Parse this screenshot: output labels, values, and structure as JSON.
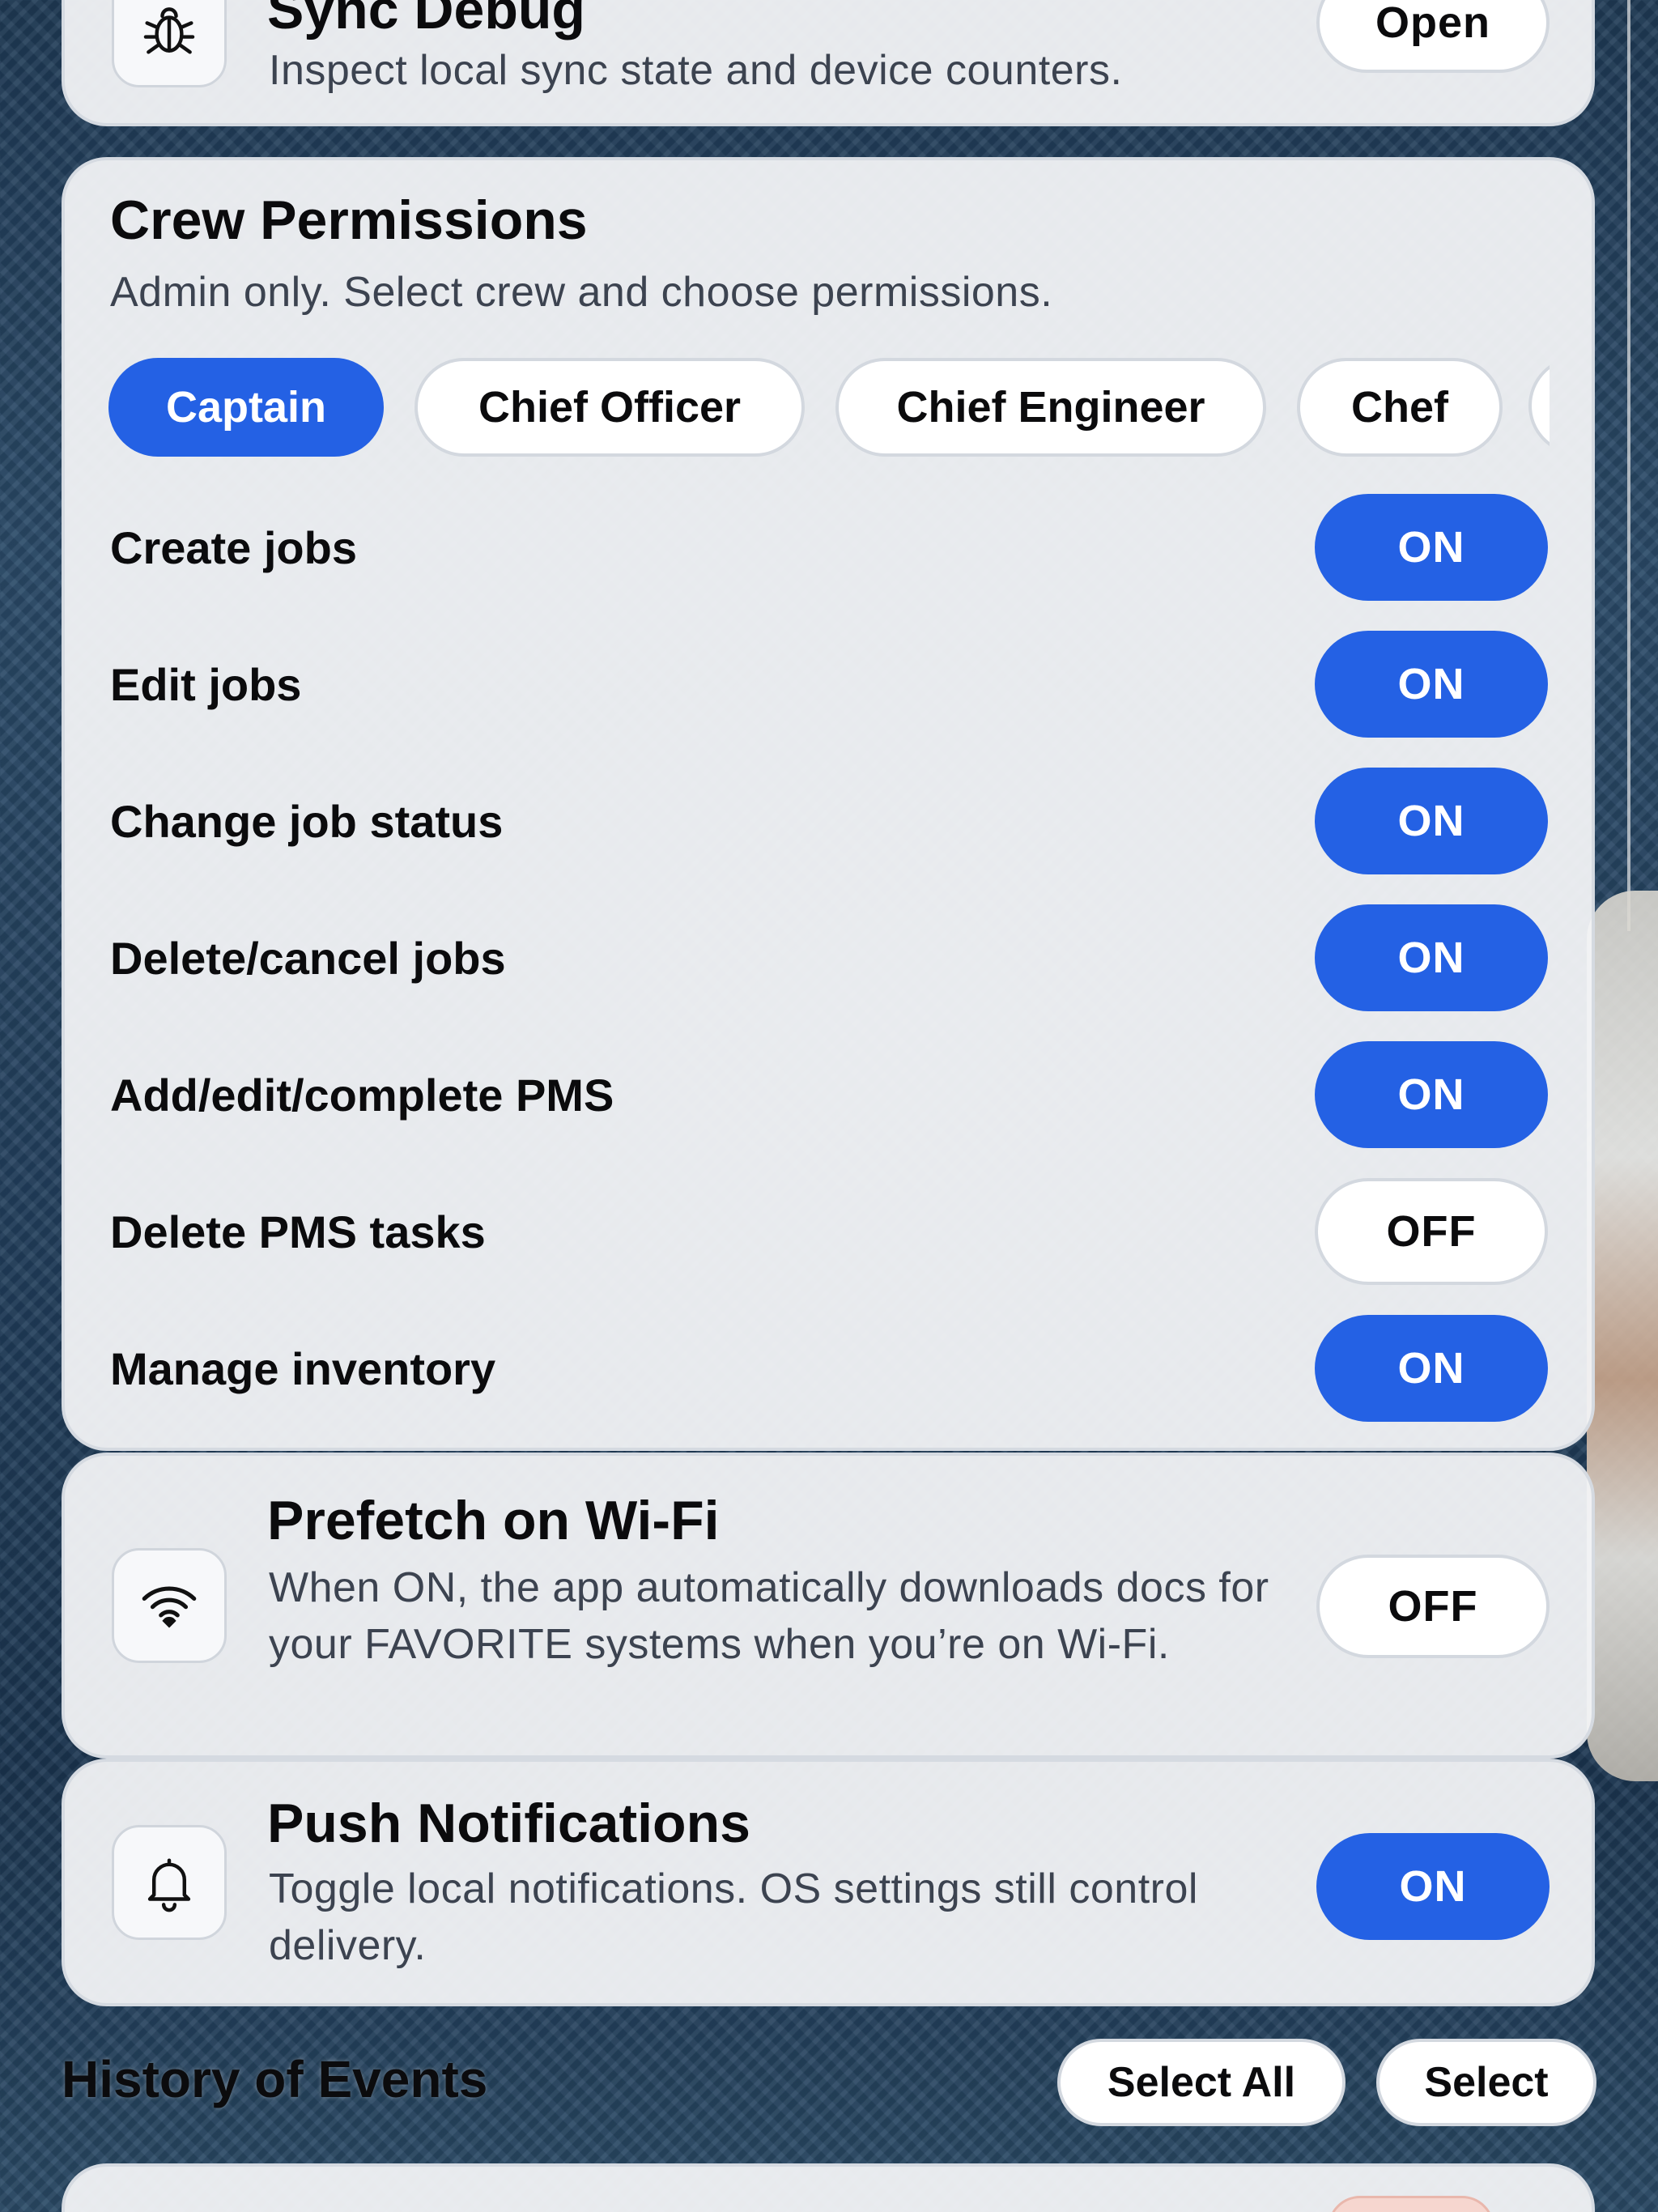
{
  "sync_debug": {
    "title": "Sync Debug",
    "description": "Inspect local sync state and device counters.",
    "button": "Open",
    "icon": "bug-icon"
  },
  "crew_permissions": {
    "title": "Crew Permissions",
    "subtitle": "Admin only. Select crew and choose permissions.",
    "crew": [
      "Captain",
      "Chief Officer",
      "Chief Engineer",
      "Chef"
    ],
    "selected_crew": "Captain",
    "permissions": [
      {
        "label": "Create jobs",
        "state": "ON"
      },
      {
        "label": "Edit jobs",
        "state": "ON"
      },
      {
        "label": "Change job status",
        "state": "ON"
      },
      {
        "label": "Delete/cancel jobs",
        "state": "ON"
      },
      {
        "label": "Add/edit/complete PMS",
        "state": "ON"
      },
      {
        "label": "Delete PMS tasks",
        "state": "OFF"
      },
      {
        "label": "Manage inventory",
        "state": "ON"
      }
    ]
  },
  "prefetch": {
    "title": "Prefetch on Wi-Fi",
    "description": "When ON, the app automatically downloads docs for your FAVORITE systems when you’re on Wi-Fi.",
    "state": "OFF",
    "icon": "wifi-icon"
  },
  "push": {
    "title": "Push Notifications",
    "description": "Toggle local notifications. OS settings still control delivery.",
    "state": "ON",
    "icon": "bell-icon"
  },
  "history": {
    "title": "History of Events",
    "select_all": "Select All",
    "select": "Select"
  },
  "colors": {
    "accent": "#2461e4",
    "card_bg": "#f2f3f6",
    "border": "#d3d8df"
  }
}
